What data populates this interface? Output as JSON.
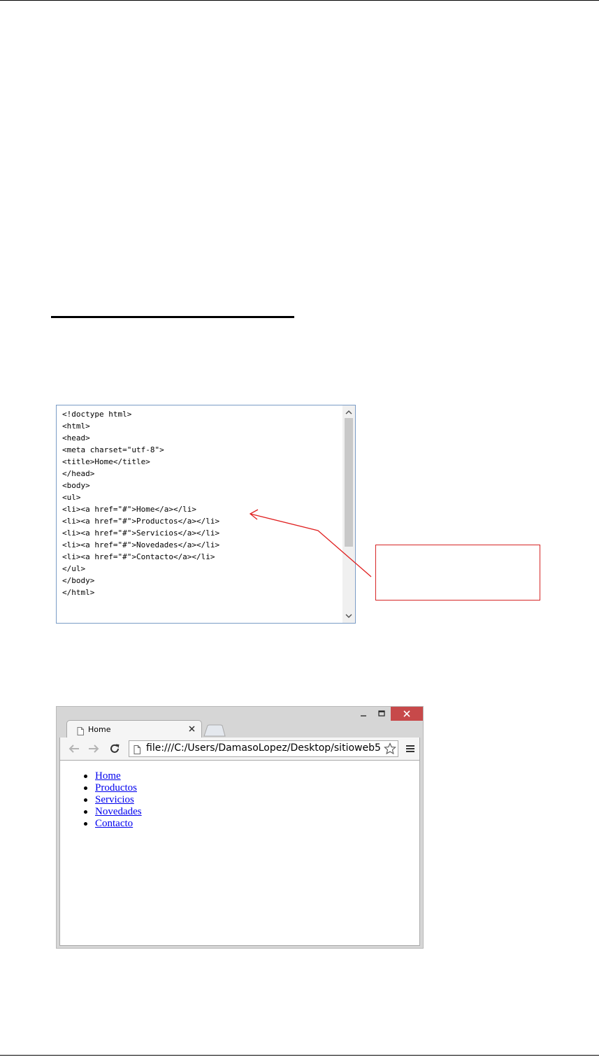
{
  "code_editor": {
    "lines": [
      "<!doctype html>",
      "<html>",
      "<head>",
      "<meta charset=\"utf-8\">",
      "<title>Home</title>",
      "</head>",
      "<body>",
      "<ul>",
      "<li><a href=\"#\">Home</a></li>",
      "<li><a href=\"#\">Productos</a></li>",
      "<li><a href=\"#\">Servicios</a></li>",
      "<li><a href=\"#\">Novedades</a></li>",
      "<li><a href=\"#\">Contacto</a></li>",
      "</ul>",
      "</body>",
      "</html>"
    ]
  },
  "annotation": {
    "color": "#d62424"
  },
  "browser": {
    "tab_title": "Home",
    "url": "file:///C:/Users/DamasoLopez/Desktop/sitioweb5",
    "links": [
      "Home",
      "Productos",
      "Servicios",
      "Novedades",
      "Contacto"
    ],
    "link_color": "#0000ee",
    "close_button_color": "#c7494a"
  },
  "icons": {
    "tab": [
      "document-icon",
      "close-icon"
    ],
    "toolbar": [
      "back-arrow-icon",
      "forward-arrow-icon",
      "reload-icon",
      "page-icon",
      "star-icon",
      "menu-icon"
    ],
    "window": [
      "minimize-icon",
      "maximize-icon",
      "window-close-icon"
    ]
  }
}
